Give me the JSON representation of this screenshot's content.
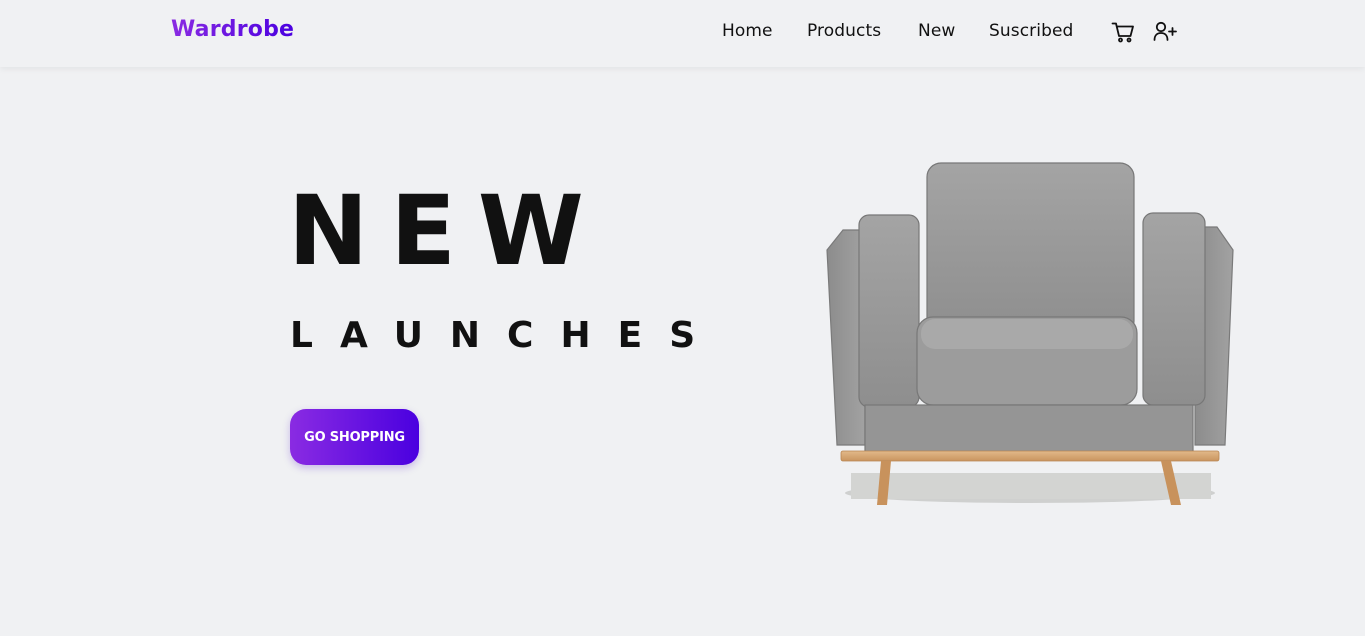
{
  "brand": {
    "name": "Wardrobe",
    "gradient_start": "#8a2be2",
    "gradient_end": "#4a00e0"
  },
  "nav": {
    "links": [
      "Home",
      "Products",
      "New",
      "Suscribed"
    ],
    "icons": [
      "cart-icon",
      "add-user-icon"
    ]
  },
  "hero": {
    "headline": "NEW",
    "subheadline": "LAUNCHES",
    "cta_label": "GO SHOPPING",
    "image": "armchair-image"
  },
  "colors": {
    "background": "#f0f1f3",
    "text": "#111111"
  }
}
